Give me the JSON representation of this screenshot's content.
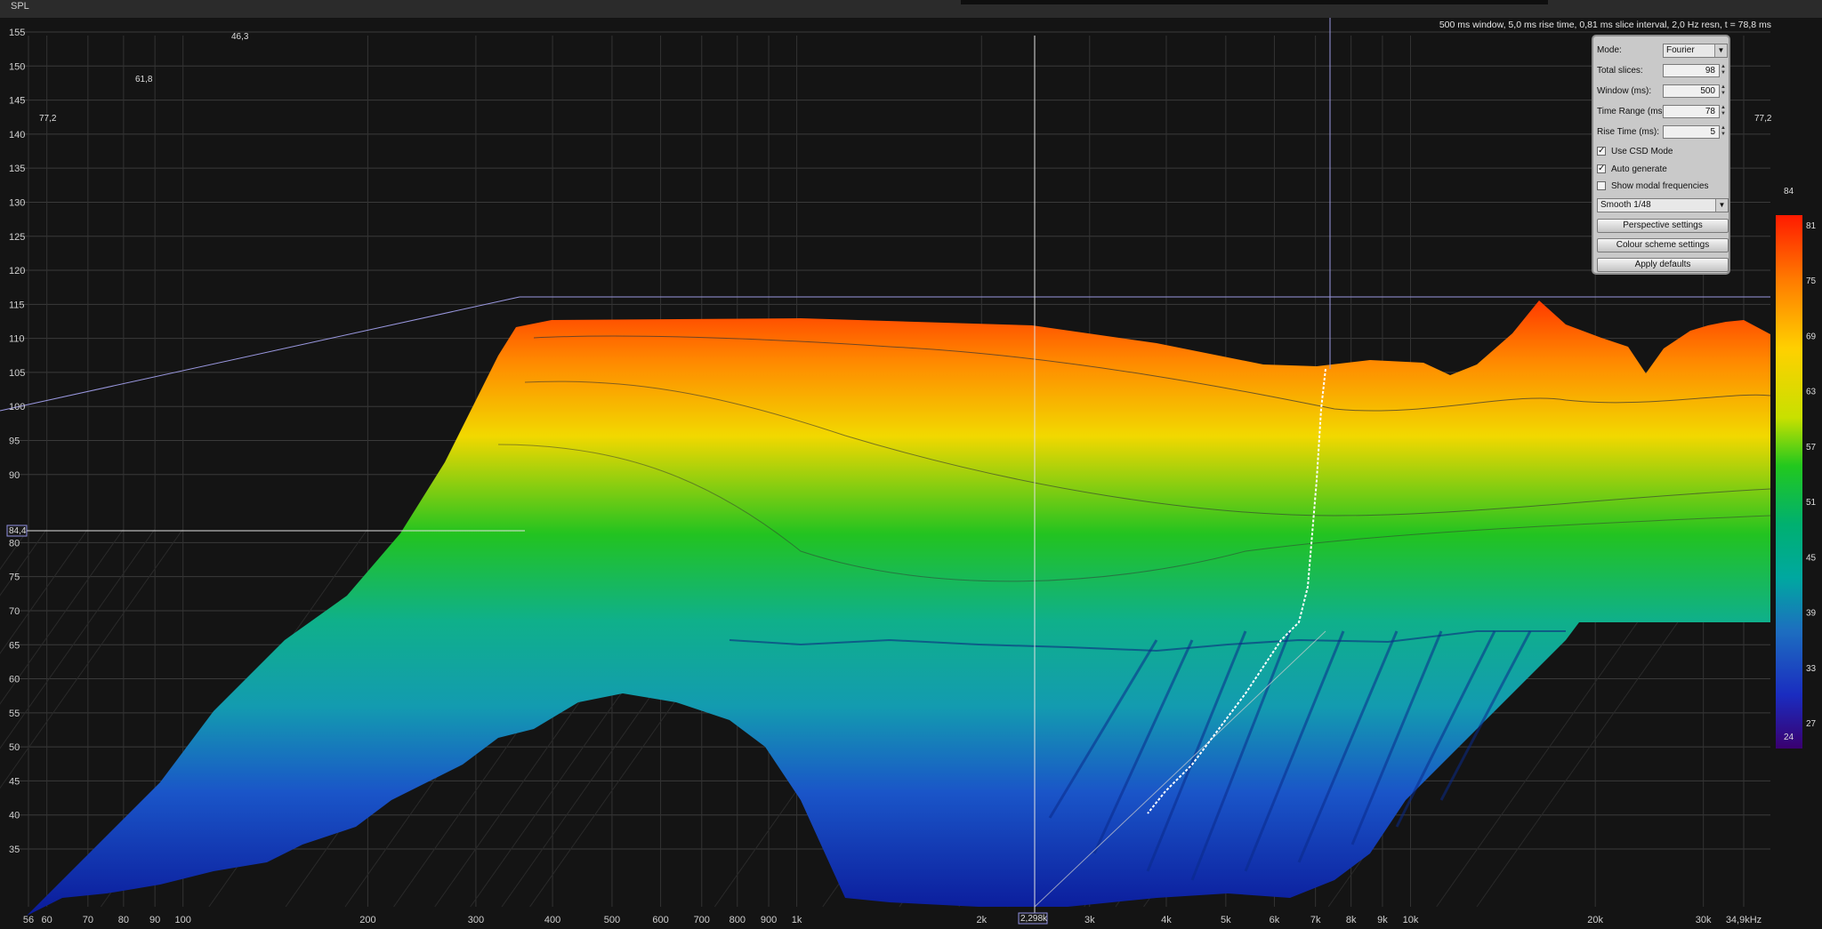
{
  "header": {
    "axis_title": "SPL"
  },
  "info_text": "500 ms window, 5,0 ms rise time, 0,81 ms slice interval, 2,0 Hz resn, t = 78,8 ms",
  "y_ticks": [
    "155",
    "150",
    "145",
    "140",
    "135",
    "130",
    "125",
    "120",
    "115",
    "110",
    "105",
    "100",
    "95",
    "90",
    "80",
    "75",
    "70",
    "65",
    "60",
    "55",
    "50",
    "45",
    "40",
    "35"
  ],
  "x_ticks": [
    "56",
    "60",
    "70",
    "80",
    "90",
    "100",
    "200",
    "300",
    "400",
    "500",
    "600",
    "700",
    "800",
    "900",
    "1k",
    "2k",
    "3k",
    "4k",
    "5k",
    "6k",
    "7k",
    "8k",
    "9k",
    "10k",
    "20k",
    "30k",
    "34,9kHz"
  ],
  "cursor": {
    "spl_readout": "84,4",
    "freq_readout": "2,298k"
  },
  "time_labels": [
    "46,3",
    "61,8",
    "77,2",
    "77,2"
  ],
  "panel": {
    "mode_label": "Mode:",
    "mode_value": "Fourier",
    "total_slices_label": "Total slices:",
    "total_slices_value": "98",
    "window_label": "Window (ms):",
    "window_value": "500",
    "time_range_label": "Time Range (ms):",
    "time_range_value": "78",
    "rise_time_label": "Rise Time (ms):",
    "rise_time_value": "5",
    "use_csd_label": "Use CSD Mode",
    "use_csd_checked": true,
    "auto_generate_label": "Auto generate",
    "auto_generate_checked": true,
    "show_modal_label": "Show modal frequencies",
    "show_modal_checked": false,
    "smoothing_value": "Smooth 1/48",
    "perspective_button": "Perspective settings",
    "colour_button": "Colour scheme settings",
    "defaults_button": "Apply defaults"
  },
  "colour_scale": {
    "max": "84",
    "min": "24",
    "labels": [
      "81",
      "75",
      "69",
      "63",
      "57",
      "51",
      "45",
      "39",
      "33",
      "27"
    ],
    "colors": [
      "#ff1a00",
      "#ff7a00",
      "#ffd000",
      "#c8e000",
      "#22c81e",
      "#00b070",
      "#00a8a0",
      "#1d6ec0",
      "#1a2cc0",
      "#3a0070"
    ]
  }
}
